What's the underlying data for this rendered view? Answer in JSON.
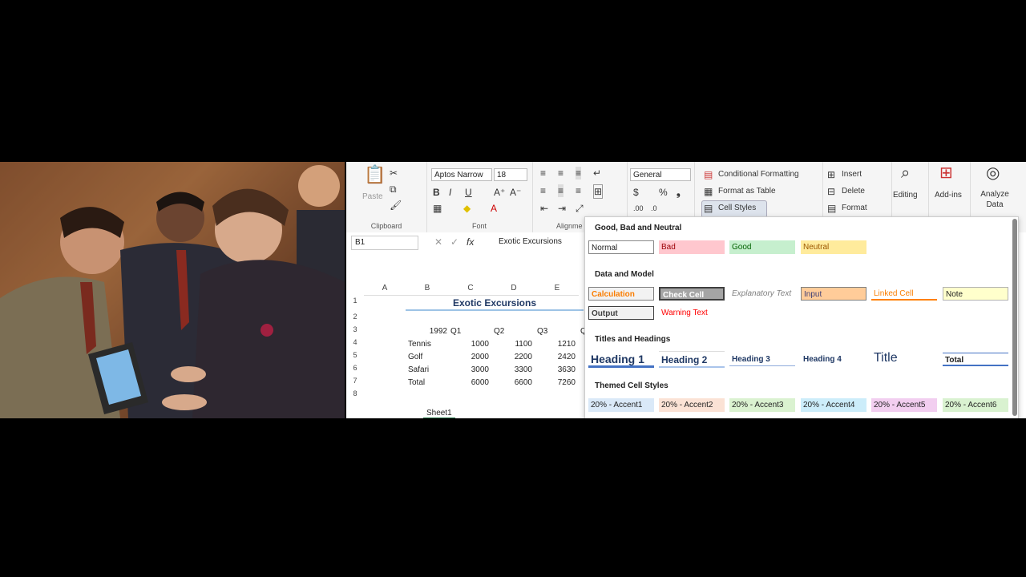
{
  "ribbon": {
    "clipboard": {
      "paste": "Paste",
      "label": "Clipboard"
    },
    "font": {
      "name": "Aptos Narrow",
      "size": "18",
      "label": "Font"
    },
    "alignment": {
      "label": "Alignme"
    },
    "number": {
      "format": "General"
    },
    "styles": {
      "conditional": "Conditional Formatting",
      "format_table": "Format as Table",
      "cell_styles": "Cell Styles"
    },
    "cells": {
      "insert": "Insert",
      "delete": "Delete",
      "format": "Format"
    },
    "editing": "Editing",
    "addins": "Add-ins",
    "analyze": "Analyze Data"
  },
  "formula_bar": {
    "name_box": "B1",
    "fx": "fx",
    "value": "Exotic Excursions"
  },
  "sheet": {
    "columns": [
      "A",
      "B",
      "C",
      "D",
      "E"
    ],
    "rows": [
      "1",
      "2",
      "3",
      "4",
      "5",
      "6",
      "7",
      "8"
    ],
    "title": "Exotic Excursions",
    "header": [
      "1992",
      "Q1",
      "Q2",
      "Q3",
      "Q"
    ],
    "data": [
      {
        "label": "Tennis",
        "c": "1000",
        "d": "1100",
        "e": "1210"
      },
      {
        "label": "Golf",
        "c": "2000",
        "d": "2200",
        "e": "2420"
      },
      {
        "label": "Safari",
        "c": "3000",
        "d": "3300",
        "e": "3630"
      },
      {
        "label": "Total",
        "c": "6000",
        "d": "6600",
        "e": "7260"
      }
    ],
    "tab": "Sheet1"
  },
  "cell_styles": {
    "sections": [
      "Good, Bad and Neutral",
      "Data and Model",
      "Titles and Headings",
      "Themed Cell Styles"
    ],
    "good_bad": [
      "Normal",
      "Bad",
      "Good",
      "Neutral"
    ],
    "data_model_1": [
      "Calculation",
      "Check Cell",
      "Explanatory Text",
      "Input",
      "Linked Cell",
      "Note"
    ],
    "data_model_2": [
      "Output",
      "Warning Text"
    ],
    "titles": [
      "Heading 1",
      "Heading 2",
      "Heading 3",
      "Heading 4",
      "Title",
      "Total"
    ],
    "themed": [
      "20% - Accent1",
      "20% - Accent2",
      "20% - Accent3",
      "20% - Accent4",
      "20% - Accent5",
      "20% - Accent6"
    ]
  }
}
